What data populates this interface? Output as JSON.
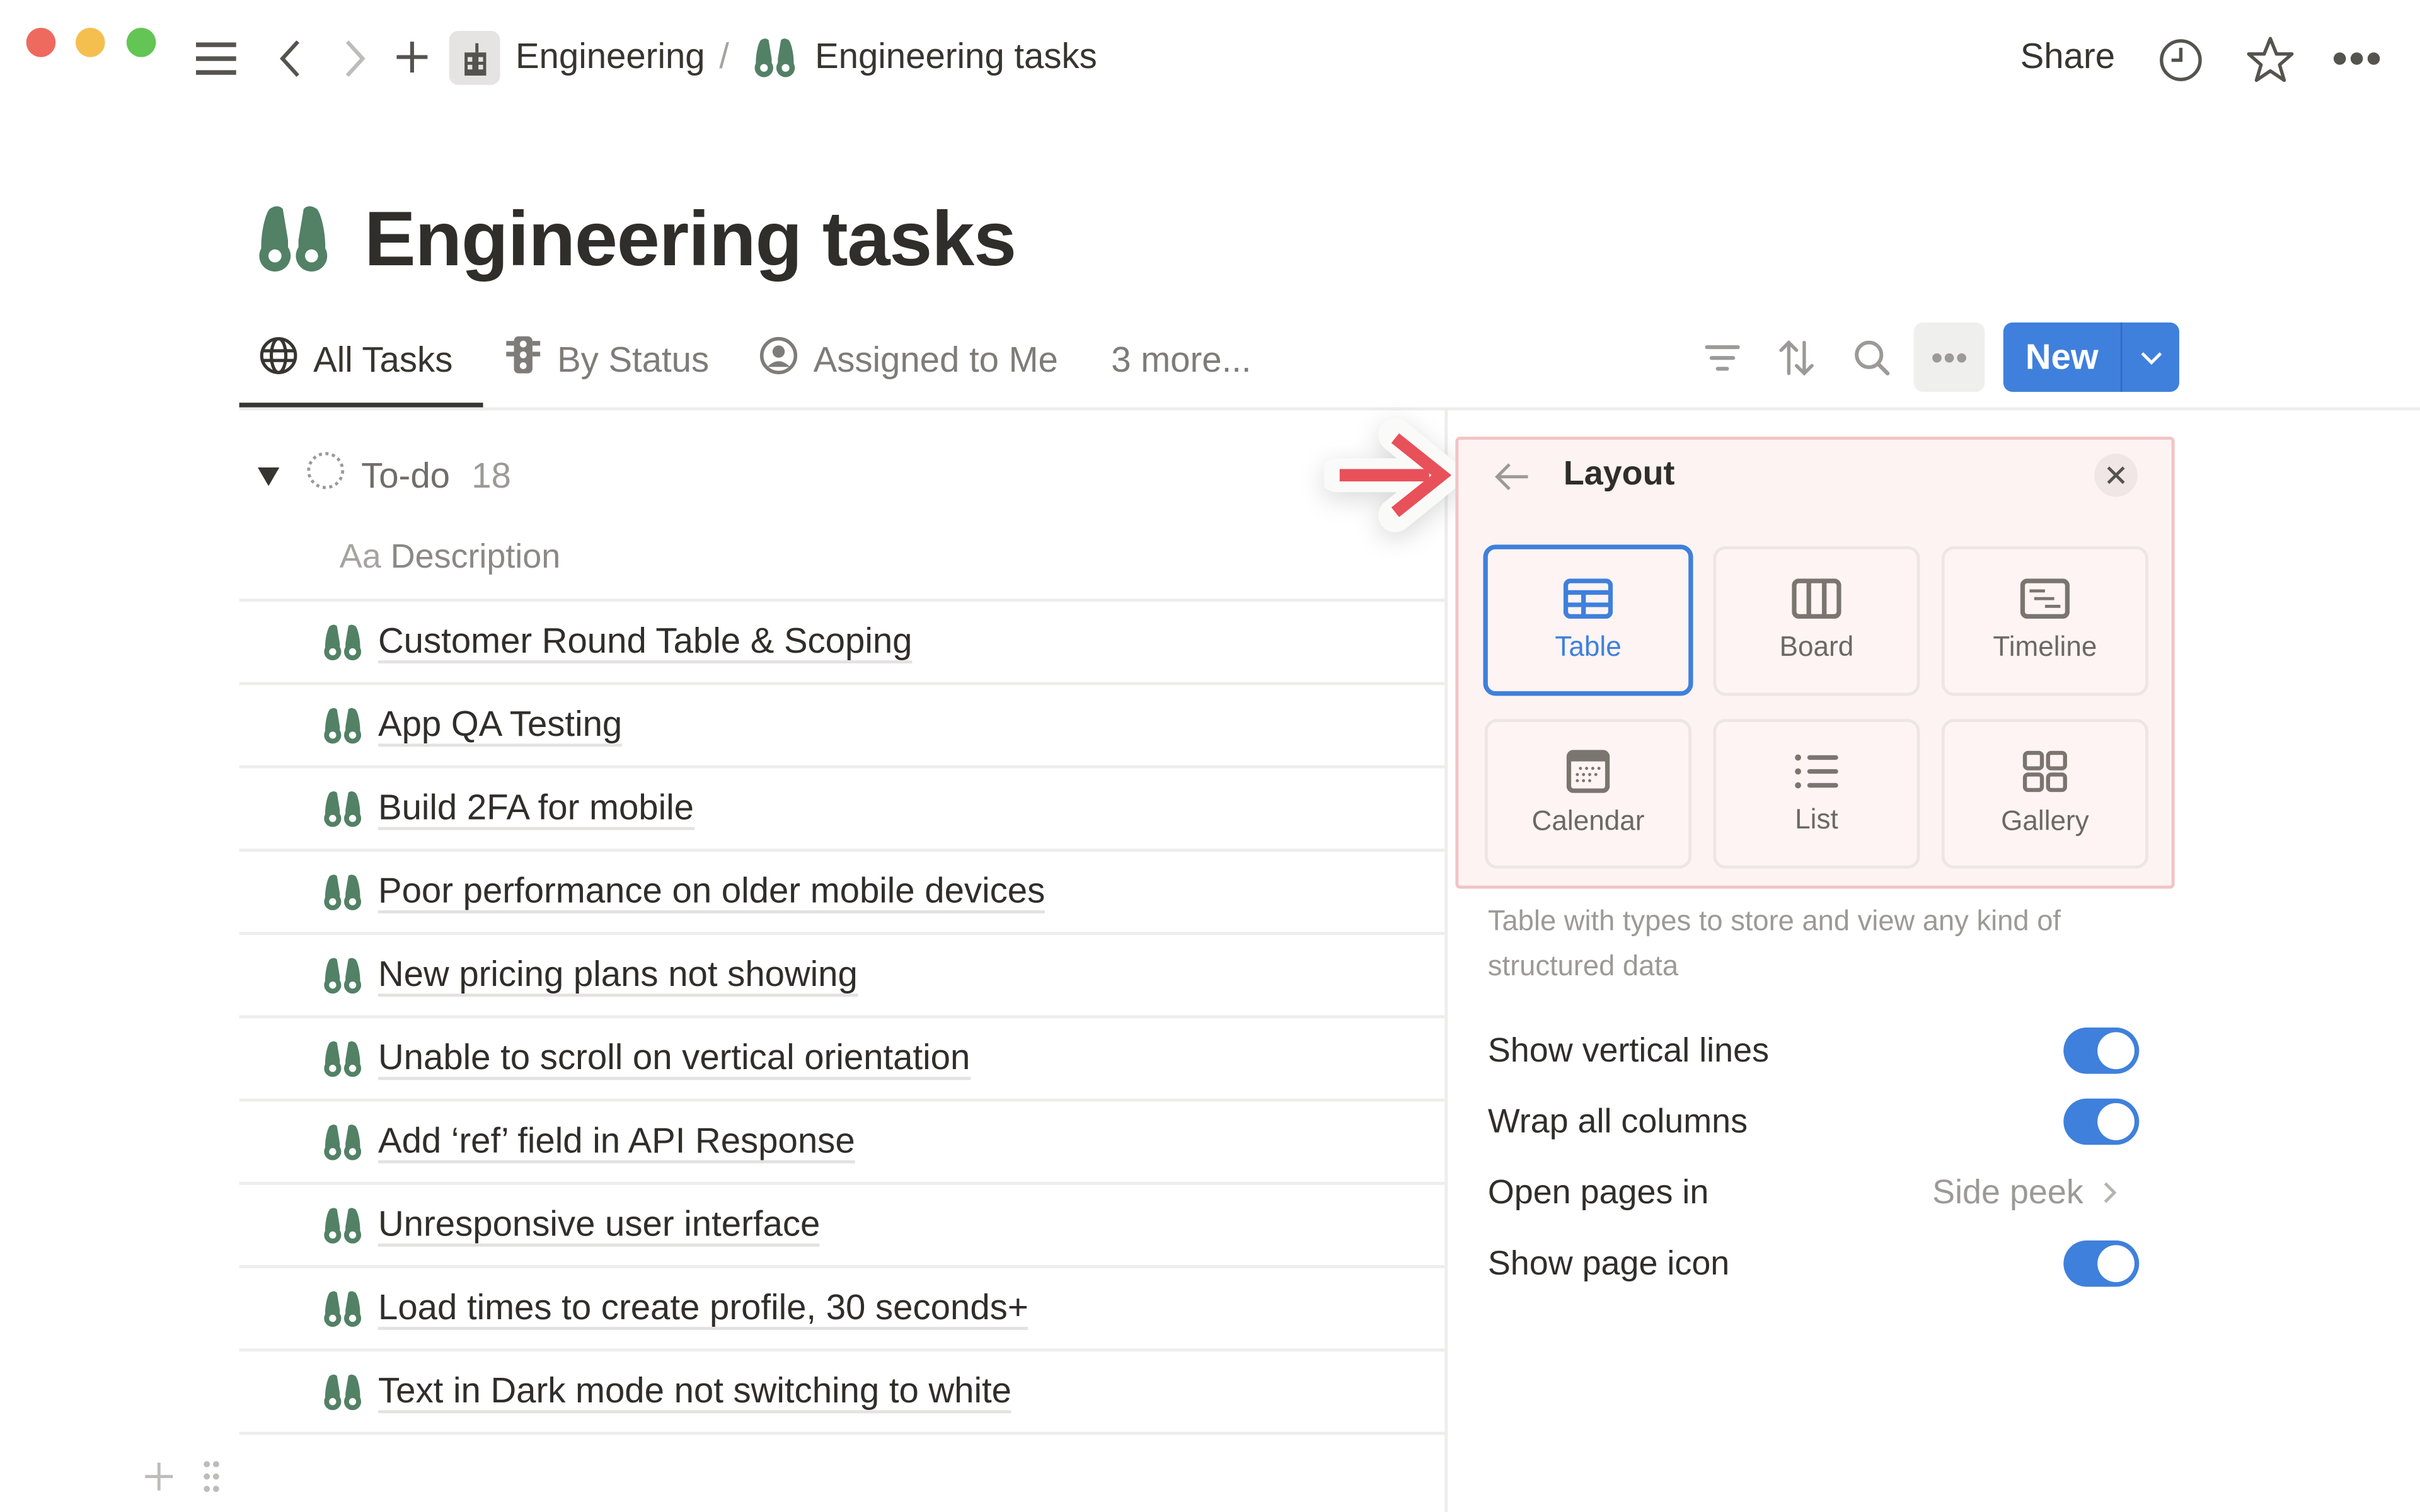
{
  "window": {
    "traffic_lights": {
      "close": "#ee6a5f",
      "minimize": "#f5bf4f",
      "zoom": "#62c554"
    }
  },
  "topbar": {
    "breadcrumb": [
      {
        "label": "Engineering",
        "icon": "building-icon"
      },
      {
        "separator": "/"
      },
      {
        "label": "Engineering tasks",
        "icon": "binoculars-icon"
      }
    ],
    "share_label": "Share",
    "icons": [
      "sidebar-menu-icon",
      "back-icon",
      "forward-icon",
      "plus-icon",
      "history-clock-icon",
      "favorite-star-icon",
      "more-dots-icon"
    ]
  },
  "page": {
    "title": "Engineering tasks",
    "icon": "binoculars-icon",
    "icon_color": "#528165"
  },
  "views": {
    "tabs": [
      {
        "label": "All Tasks",
        "icon": "globe-icon",
        "active": true
      },
      {
        "label": "By Status",
        "icon": "traffic-light-icon",
        "active": false
      },
      {
        "label": "Assigned to Me",
        "icon": "user-circle-icon",
        "active": false
      },
      {
        "label": "3 more...",
        "active": false
      }
    ],
    "toolbar": {
      "icons": [
        "filter-icon",
        "sort-icon",
        "search-icon",
        "more-dots-icon"
      ],
      "new_label": "New",
      "new_color": "#3f80dc"
    }
  },
  "table": {
    "group": {
      "label": "To-do",
      "count": "18"
    },
    "column_header": {
      "prefix": "Aa",
      "label": "Description"
    },
    "rows": [
      "Customer Round Table & Scoping",
      "App QA Testing",
      "Build 2FA for mobile",
      "Poor performance on older mobile devices",
      "New pricing plans not showing",
      "Unable to scroll on vertical orientation",
      "Add ‘ref’ field in API Response",
      "Unresponsive user interface",
      "Load times to create profile, 30 seconds+",
      "Text in Dark mode not switching to white"
    ]
  },
  "layout_panel": {
    "title": "Layout",
    "layouts": [
      {
        "label": "Table",
        "icon": "table-icon",
        "selected": true
      },
      {
        "label": "Board",
        "icon": "board-icon",
        "selected": false
      },
      {
        "label": "Timeline",
        "icon": "timeline-icon",
        "selected": false
      },
      {
        "label": "Calendar",
        "icon": "calendar-icon",
        "selected": false
      },
      {
        "label": "List",
        "icon": "list-icon",
        "selected": false
      },
      {
        "label": "Gallery",
        "icon": "gallery-icon",
        "selected": false
      }
    ],
    "description": "Table with types to store and view any kind of structured data",
    "settings": [
      {
        "label": "Show vertical lines",
        "type": "toggle",
        "value": true
      },
      {
        "label": "Wrap all columns",
        "type": "toggle",
        "value": true
      },
      {
        "label": "Open pages in",
        "type": "select",
        "value": "Side peek"
      },
      {
        "label": "Show page icon",
        "type": "toggle",
        "value": true
      }
    ],
    "highlight_arrow_color": "#e8505a"
  }
}
